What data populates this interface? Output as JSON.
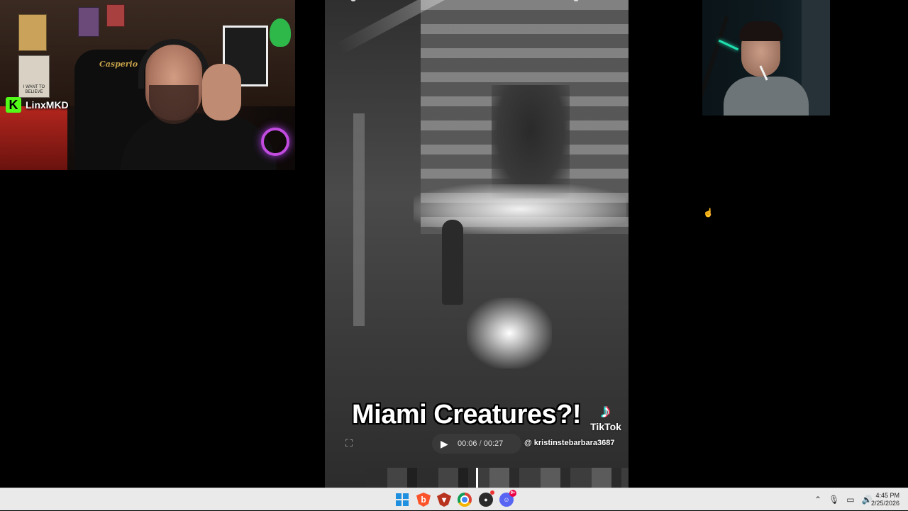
{
  "webcam_left": {
    "channel_name": "LinxMKD",
    "chair_brand": "Casperio",
    "poster_text": "I WANT TO BELIEVE"
  },
  "video": {
    "caption": "Miami Creatures?!",
    "watermark": "TikTok",
    "uploader": "@ kristinstebarbara3687",
    "current_time": "00:06",
    "duration": "00:27",
    "progress_fraction": 0.42
  },
  "taskbar": {
    "icons": [
      "windows-start-icon",
      "brave-browser-icon",
      "shield-app-icon",
      "chrome-icon",
      "obs-icon",
      "discord-icon"
    ],
    "discord_badge": "9+",
    "clock_time": "4:45 PM",
    "clock_date": "2/25/2026"
  },
  "colors": {
    "kick_green": "#53fc18",
    "taskbar_bg": "#eaeaea",
    "windows_blue": "#1f8fe0"
  }
}
